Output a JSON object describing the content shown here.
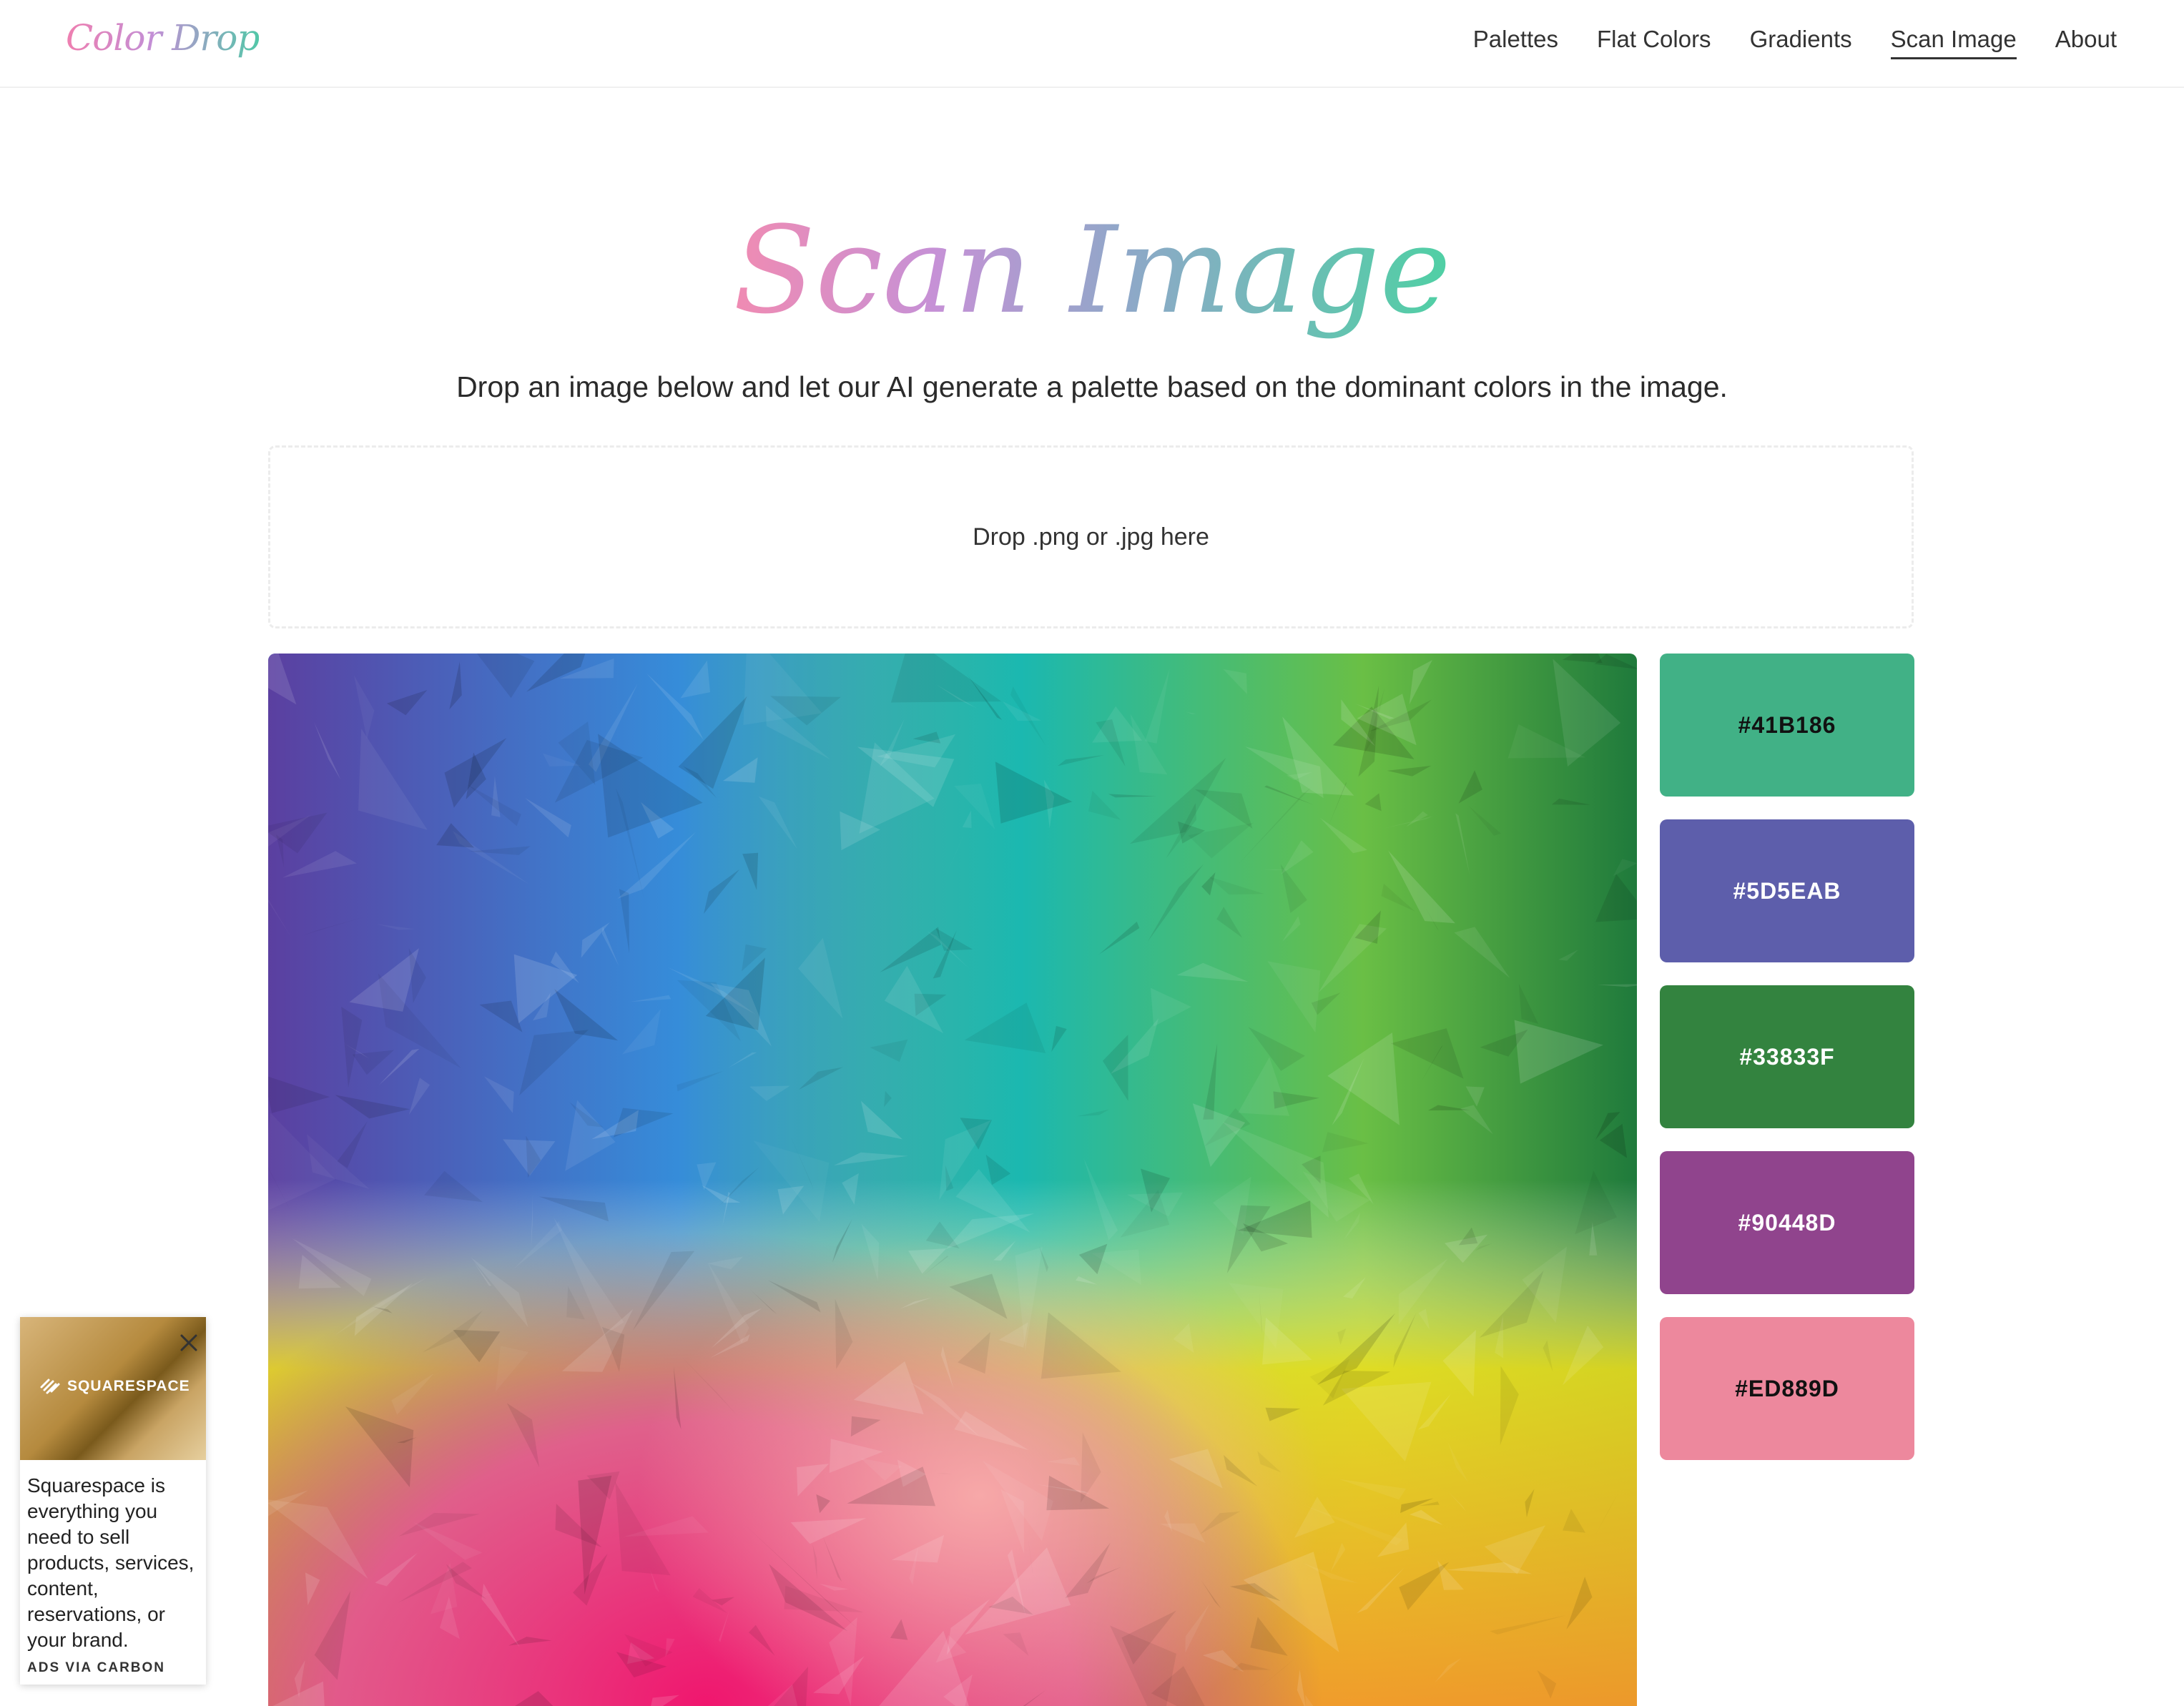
{
  "header": {
    "logo": "Color Drop",
    "nav": [
      "Palettes",
      "Flat Colors",
      "Gradients",
      "Scan Image",
      "About"
    ],
    "active": "Scan Image"
  },
  "main": {
    "title": "Scan Image",
    "subtitle": "Drop an image below and let our AI generate a palette based on the dominant colors in the image.",
    "dropzone_label": "Drop .png or .jpg here"
  },
  "palette": [
    {
      "hex": "#41B186",
      "text_color": "#111111"
    },
    {
      "hex": "#5D5EAB",
      "text_color": "#ffffff"
    },
    {
      "hex": "#33833F",
      "text_color": "#ffffff"
    },
    {
      "hex": "#90448D",
      "text_color": "#ffffff"
    },
    {
      "hex": "#ED889D",
      "text_color": "#111111"
    }
  ],
  "ad": {
    "brand": "SQUARESPACE",
    "text": "Squarespace is everything you need to sell products, services, content, reservations, or your brand.",
    "via": "ADS VIA CARBON"
  }
}
